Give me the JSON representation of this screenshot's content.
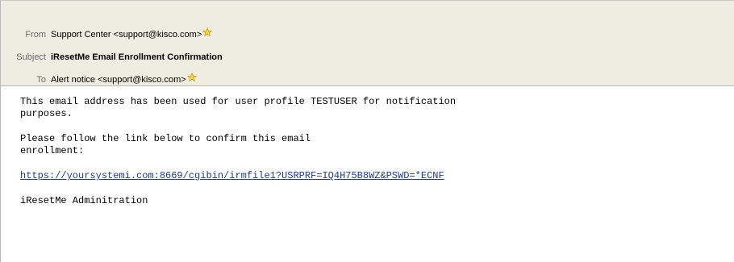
{
  "header": {
    "from": {
      "label": "From",
      "value": "Support Center <support@kisco.com>"
    },
    "subject": {
      "label": "Subject",
      "value": "iResetMe Email Enrollment Confirmation"
    },
    "to": {
      "label": "To",
      "value": "Alert notice <support@kisco.com>"
    }
  },
  "body": {
    "paragraph1_line1": "This email address has been used for user profile TESTUSER for notification",
    "paragraph1_line2": "purposes.",
    "paragraph2_line1": "Please follow the link below to confirm this email",
    "paragraph2_line2": "enrollment:",
    "link": "https://yoursystemi.com:8669/cgibin/irmfile1?USRPRF=IQ4H75B8WZ&PSWD=*ECNF",
    "signature": "iResetMe Adminitration"
  },
  "icons": {
    "contact_star": "star-icon",
    "star_color": "#f5c518"
  },
  "colors": {
    "header_bg": "#efece1",
    "link": "#1a3a99"
  }
}
